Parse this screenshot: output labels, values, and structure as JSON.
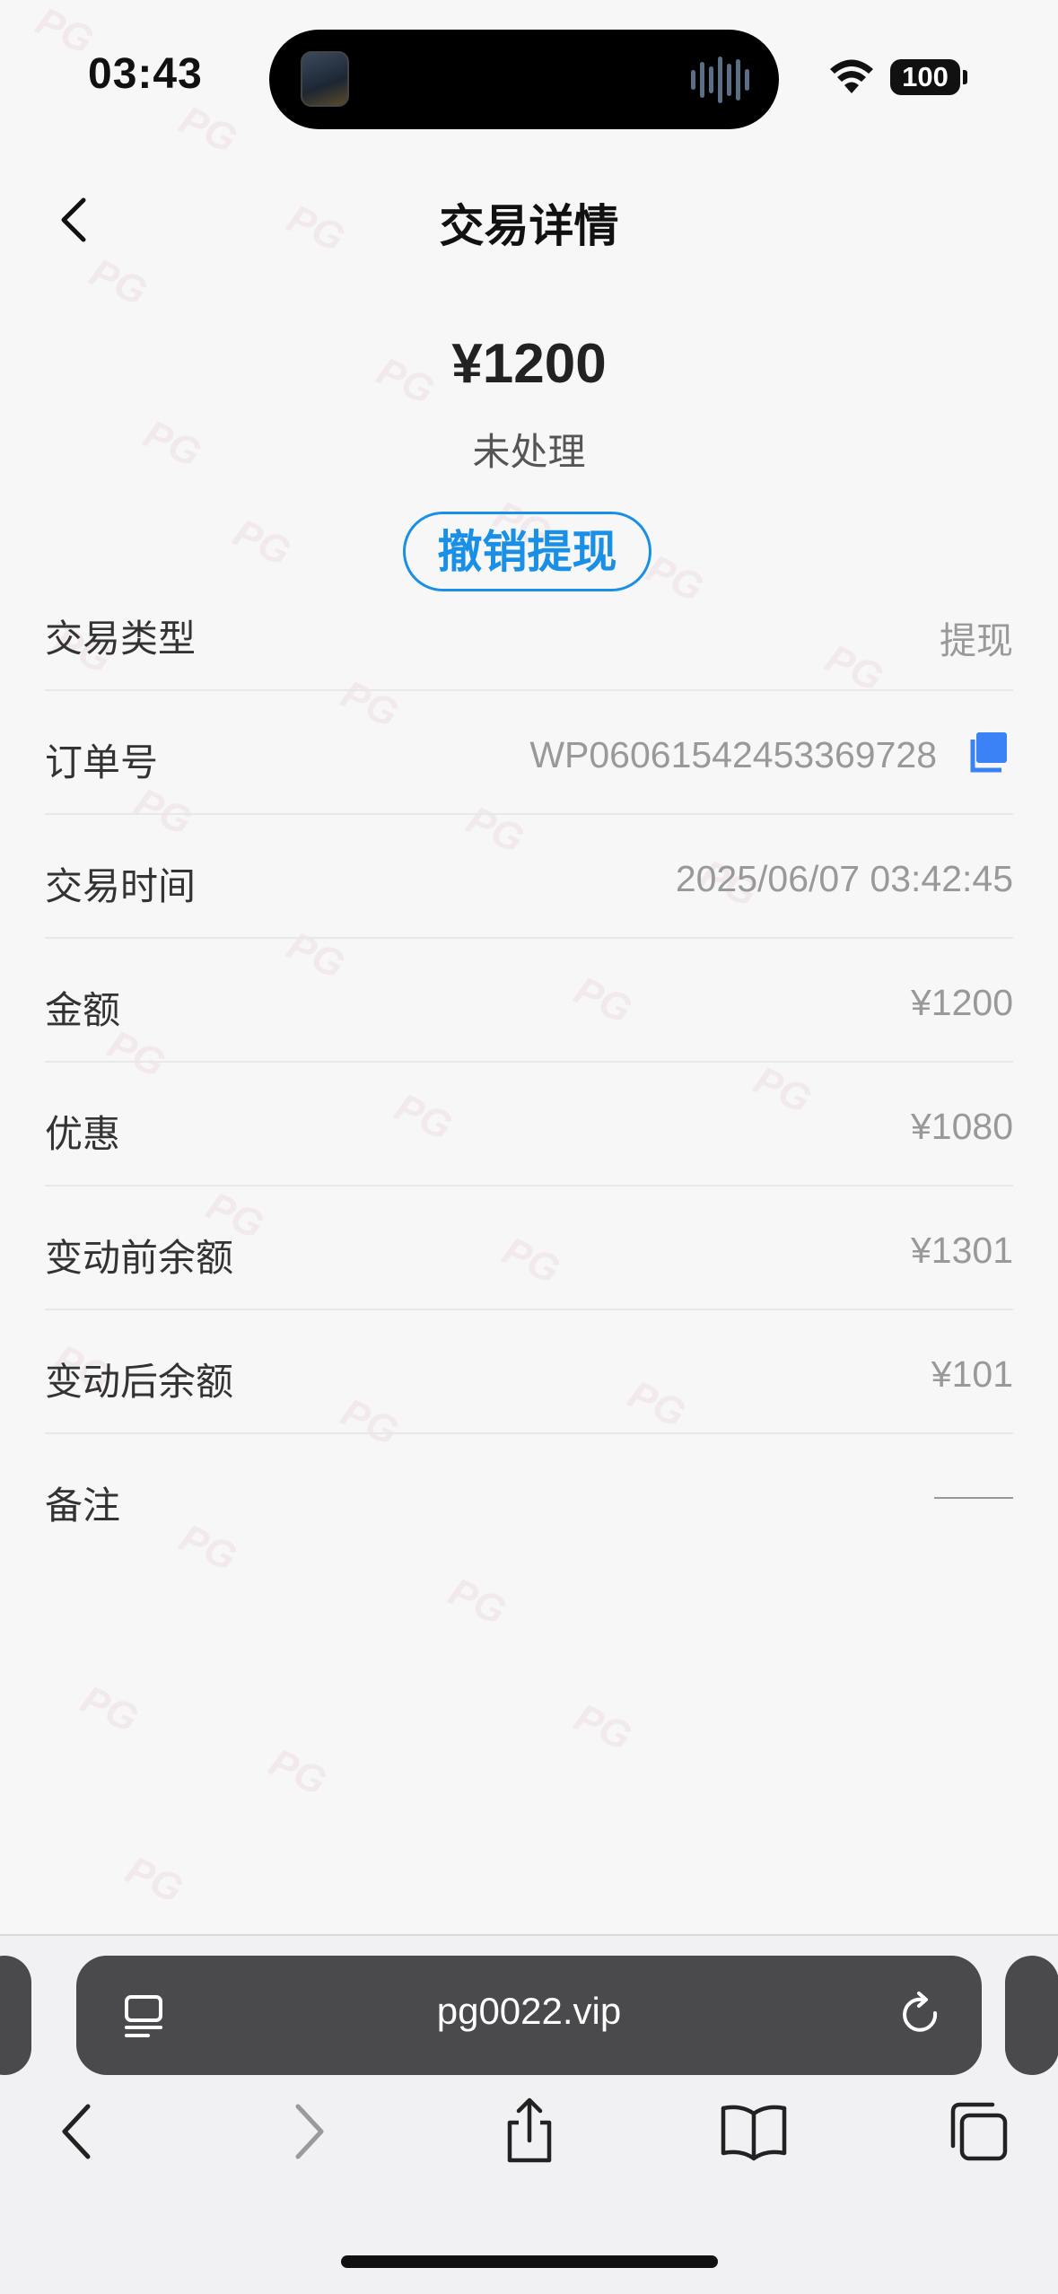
{
  "status_bar": {
    "time": "03:43",
    "battery": "100"
  },
  "header": {
    "title": "交易详情"
  },
  "summary": {
    "amount": "¥1200",
    "state": "未处理",
    "cancel_label": "撤销提现"
  },
  "details": {
    "rows": [
      {
        "label": "交易类型",
        "value": "提现"
      },
      {
        "label": "订单号",
        "value": "WP06061542453369728"
      },
      {
        "label": "交易时间",
        "value": "2025/06/07 03:42:45"
      },
      {
        "label": "金额",
        "value": "¥1200"
      },
      {
        "label": "优惠",
        "value": "¥1080"
      },
      {
        "label": "变动前余额",
        "value": "¥1301"
      },
      {
        "label": "变动后余额",
        "value": "¥101"
      },
      {
        "label": "备注",
        "value": ""
      }
    ]
  },
  "watermark": "PG",
  "browser": {
    "url": "pg0022.vip"
  },
  "colors": {
    "accent": "#1a8fe6",
    "copy_icon": "#3b82f6"
  }
}
